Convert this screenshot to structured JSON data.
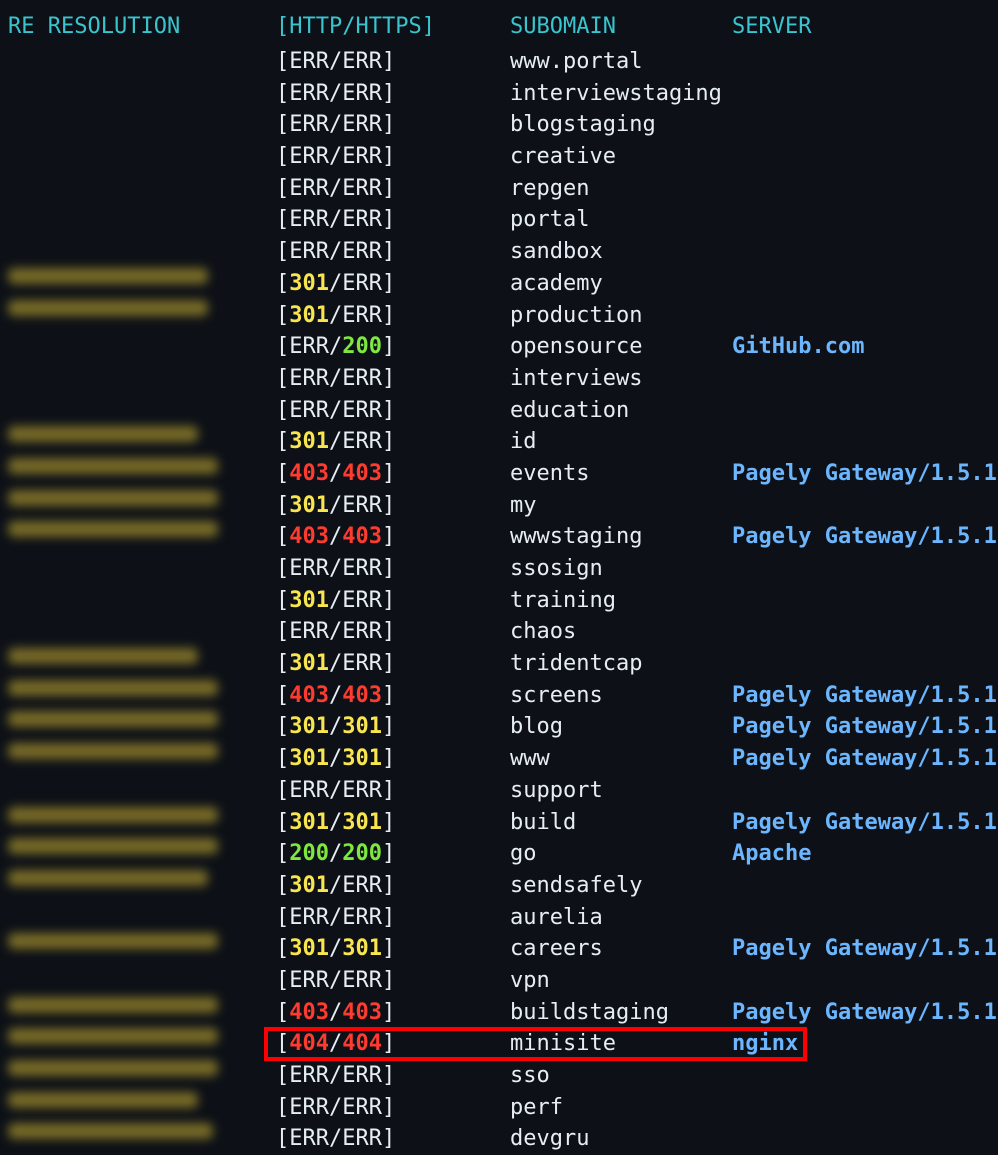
{
  "headers": {
    "resolution": "RE RESOLUTION",
    "http_https": "[HTTP/HTTPS]",
    "subdomain": "SUBOMAIN",
    "server": "SERVER"
  },
  "colors": {
    "background": "#0d1117",
    "header": "#39c5cf",
    "code_301": "#f9e64f",
    "code_200": "#7ee83f",
    "code_403_404": "#ff3b30",
    "server": "#6cb6ff",
    "highlight": "#ff0000"
  },
  "rows": [
    {
      "blurred_ip": false,
      "http": "ERR",
      "https": "ERR",
      "http_color": "gray",
      "https_color": "gray",
      "subdomain": "www.portal",
      "server": ""
    },
    {
      "blurred_ip": false,
      "http": "ERR",
      "https": "ERR",
      "http_color": "gray",
      "https_color": "gray",
      "subdomain": "interviewstaging",
      "server": ""
    },
    {
      "blurred_ip": false,
      "http": "ERR",
      "https": "ERR",
      "http_color": "gray",
      "https_color": "gray",
      "subdomain": "blogstaging",
      "server": ""
    },
    {
      "blurred_ip": false,
      "http": "ERR",
      "https": "ERR",
      "http_color": "gray",
      "https_color": "gray",
      "subdomain": "creative",
      "server": ""
    },
    {
      "blurred_ip": false,
      "http": "ERR",
      "https": "ERR",
      "http_color": "gray",
      "https_color": "gray",
      "subdomain": "repgen",
      "server": ""
    },
    {
      "blurred_ip": false,
      "http": "ERR",
      "https": "ERR",
      "http_color": "gray",
      "https_color": "gray",
      "subdomain": "portal",
      "server": ""
    },
    {
      "blurred_ip": false,
      "http": "ERR",
      "https": "ERR",
      "http_color": "gray",
      "https_color": "gray",
      "subdomain": "sandbox",
      "server": ""
    },
    {
      "blurred_ip": true,
      "http": "301",
      "https": "ERR",
      "http_color": "yellow",
      "https_color": "gray",
      "subdomain": "academy",
      "server": ""
    },
    {
      "blurred_ip": true,
      "http": "301",
      "https": "ERR",
      "http_color": "yellow",
      "https_color": "gray",
      "subdomain": "production",
      "server": ""
    },
    {
      "blurred_ip": false,
      "http": "ERR",
      "https": "200",
      "http_color": "gray",
      "https_color": "green",
      "subdomain": "opensource",
      "server": "GitHub.com"
    },
    {
      "blurred_ip": false,
      "http": "ERR",
      "https": "ERR",
      "http_color": "gray",
      "https_color": "gray",
      "subdomain": "interviews",
      "server": ""
    },
    {
      "blurred_ip": false,
      "http": "ERR",
      "https": "ERR",
      "http_color": "gray",
      "https_color": "gray",
      "subdomain": "education",
      "server": ""
    },
    {
      "blurred_ip": true,
      "http": "301",
      "https": "ERR",
      "http_color": "yellow",
      "https_color": "gray",
      "subdomain": "id",
      "server": ""
    },
    {
      "blurred_ip": true,
      "http": "403",
      "https": "403",
      "http_color": "red",
      "https_color": "red",
      "subdomain": "events",
      "server": "Pagely Gateway/1.5.1"
    },
    {
      "blurred_ip": true,
      "http": "301",
      "https": "ERR",
      "http_color": "yellow",
      "https_color": "gray",
      "subdomain": "my",
      "server": ""
    },
    {
      "blurred_ip": true,
      "http": "403",
      "https": "403",
      "http_color": "red",
      "https_color": "red",
      "subdomain": "wwwstaging",
      "server": "Pagely Gateway/1.5.1"
    },
    {
      "blurred_ip": false,
      "http": "ERR",
      "https": "ERR",
      "http_color": "gray",
      "https_color": "gray",
      "subdomain": "ssosign",
      "server": ""
    },
    {
      "blurred_ip": false,
      "http": "301",
      "https": "ERR",
      "http_color": "yellow",
      "https_color": "gray",
      "subdomain": "training",
      "server": ""
    },
    {
      "blurred_ip": false,
      "http": "ERR",
      "https": "ERR",
      "http_color": "gray",
      "https_color": "gray",
      "subdomain": "chaos",
      "server": ""
    },
    {
      "blurred_ip": true,
      "http": "301",
      "https": "ERR",
      "http_color": "yellow",
      "https_color": "gray",
      "subdomain": "tridentcap",
      "server": ""
    },
    {
      "blurred_ip": true,
      "http": "403",
      "https": "403",
      "http_color": "red",
      "https_color": "red",
      "subdomain": "screens",
      "server": "Pagely Gateway/1.5.1"
    },
    {
      "blurred_ip": true,
      "http": "301",
      "https": "301",
      "http_color": "yellow",
      "https_color": "yellow",
      "subdomain": "blog",
      "server": "Pagely Gateway/1.5.1"
    },
    {
      "blurred_ip": true,
      "http": "301",
      "https": "301",
      "http_color": "yellow",
      "https_color": "yellow",
      "subdomain": "www",
      "server": "Pagely Gateway/1.5.1"
    },
    {
      "blurred_ip": false,
      "http": "ERR",
      "https": "ERR",
      "http_color": "gray",
      "https_color": "gray",
      "subdomain": "support",
      "server": ""
    },
    {
      "blurred_ip": true,
      "http": "301",
      "https": "301",
      "http_color": "yellow",
      "https_color": "yellow",
      "subdomain": "build",
      "server": "Pagely Gateway/1.5.1"
    },
    {
      "blurred_ip": true,
      "http": "200",
      "https": "200",
      "http_color": "green",
      "https_color": "green",
      "subdomain": "go",
      "server": "Apache"
    },
    {
      "blurred_ip": true,
      "http": "301",
      "https": "ERR",
      "http_color": "yellow",
      "https_color": "gray",
      "subdomain": "sendsafely",
      "server": ""
    },
    {
      "blurred_ip": false,
      "http": "ERR",
      "https": "ERR",
      "http_color": "gray",
      "https_color": "gray",
      "subdomain": "aurelia",
      "server": ""
    },
    {
      "blurred_ip": true,
      "http": "301",
      "https": "301",
      "http_color": "yellow",
      "https_color": "yellow",
      "subdomain": "careers",
      "server": "Pagely Gateway/1.5.1"
    },
    {
      "blurred_ip": false,
      "http": "ERR",
      "https": "ERR",
      "http_color": "gray",
      "https_color": "gray",
      "subdomain": "vpn",
      "server": ""
    },
    {
      "blurred_ip": true,
      "http": "403",
      "https": "403",
      "http_color": "red",
      "https_color": "red",
      "subdomain": "buildstaging",
      "server": "Pagely Gateway/1.5.1"
    },
    {
      "blurred_ip": true,
      "http": "404",
      "https": "404",
      "http_color": "red",
      "https_color": "red",
      "subdomain": "minisite",
      "server": "nginx",
      "highlighted": true
    },
    {
      "blurred_ip": true,
      "http": "ERR",
      "https": "ERR",
      "http_color": "gray",
      "https_color": "gray",
      "subdomain": "sso",
      "server": ""
    },
    {
      "blurred_ip": true,
      "http": "ERR",
      "https": "ERR",
      "http_color": "gray",
      "https_color": "gray",
      "subdomain": "perf",
      "server": ""
    },
    {
      "blurred_ip": true,
      "http": "ERR",
      "https": "ERR",
      "http_color": "gray",
      "https_color": "gray",
      "subdomain": "devgru",
      "server": ""
    }
  ]
}
